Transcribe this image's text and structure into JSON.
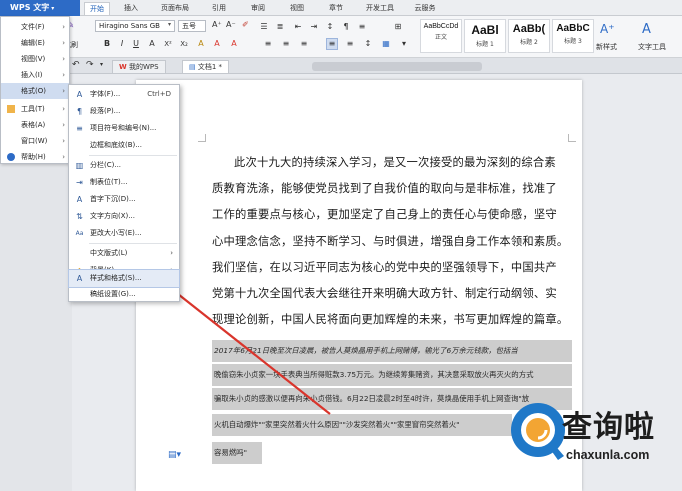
{
  "app": {
    "menu_button": "WPS 文字"
  },
  "ribbon_tabs": [
    "开始",
    "插入",
    "页面布局",
    "引用",
    "审阅",
    "视图",
    "章节",
    "开发工具",
    "云服务"
  ],
  "toolbar": {
    "font_name": "Hiragino Sans GB",
    "font_size": "五号",
    "paste_label": "式刷",
    "new_style_label": "新样式",
    "text_tools_label": "文字工具",
    "styles": [
      {
        "preview": "AaBbCcDd",
        "label": "正文"
      },
      {
        "preview": "AaBl",
        "label": "标题 1"
      },
      {
        "preview": "AaBb(",
        "label": "标题 2"
      },
      {
        "preview": "AaBbC",
        "label": "标题 3"
      }
    ]
  },
  "quickbar": {
    "doc_tabs": [
      "我的WPS",
      "文档1 *"
    ]
  },
  "main_menu": {
    "items": [
      {
        "label": "文件(F)",
        "arrow": "›"
      },
      {
        "label": "编辑(E)",
        "arrow": "›"
      },
      {
        "label": "视图(V)",
        "arrow": "›"
      },
      {
        "label": "插入(I)",
        "arrow": "›"
      },
      {
        "label": "格式(O)",
        "arrow": "›"
      },
      {
        "label": "工具(T)",
        "arrow": "›"
      },
      {
        "label": "表格(A)",
        "arrow": "›"
      },
      {
        "label": "窗口(W)",
        "arrow": "›"
      },
      {
        "label": "帮助(H)",
        "arrow": "›"
      }
    ]
  },
  "format_submenu": {
    "items": [
      {
        "icon": "A",
        "label": "字体(F)...",
        "shortcut": "Ctrl+D"
      },
      {
        "icon": "¶",
        "label": "段落(P)...",
        "shortcut": ""
      },
      {
        "icon": "≡",
        "label": "项目符号和编号(N)...",
        "shortcut": ""
      },
      {
        "icon": "",
        "label": "边框和底纹(B)...",
        "shortcut": ""
      },
      {
        "icon": "▥",
        "label": "分栏(C)...",
        "shortcut": ""
      },
      {
        "icon": "⇥",
        "label": "制表位(T)...",
        "shortcut": ""
      },
      {
        "icon": "A",
        "label": "首字下沉(D)...",
        "shortcut": ""
      },
      {
        "icon": "⇅",
        "label": "文字方向(X)...",
        "shortcut": ""
      },
      {
        "icon": "Aa",
        "label": "更改大小写(E)...",
        "shortcut": ""
      },
      {
        "icon": "",
        "label": "中文版式(L)",
        "shortcut": "›"
      },
      {
        "icon": "◆",
        "label": "背景(K)",
        "shortcut": "›"
      },
      {
        "icon": "A",
        "label": "样式和格式(S)...",
        "shortcut": ""
      },
      {
        "icon": "",
        "label": "稿纸设置(G)...",
        "shortcut": ""
      }
    ]
  },
  "document": {
    "lines": [
      "此次十九大的持续深入学习，是又一次接受的最为深刻的综合素",
      "质教育洗涤，能够使党员找到了自我价值的取向与是非标准，找准了",
      "工作的重要点与核心，更加坚定了自己身上的责任心与使命感，坚守",
      "心中理念信念，坚持不断学习、与时俱进，增强自身工作本领和素质。",
      "我们坚信，在以习近平同志为核心的党中央的坚强领导下，中国共产",
      "党第十九次全国代表大会继往开来明确大政方针、制定行动纲领、实",
      "现理论创新，中国人民将面向更加辉煌的未来，书写更加辉煌的篇章。"
    ],
    "highlighted_lines": [
      "2017年6月21日晚至次日凌晨，被告人莫焕晶用手机上网赌博，输光了6万余元钱款，包括当",
      "晚偷窃朱小贞家一块手表典当所得赃款3.75万元。为继续筹集赌资，其决意采取放火再灭火的方式",
      "骗取朱小贞的感激以便再向朱小贞借钱。6月22日凌晨2时至4时许，莫焕晶使用手机上网查询\"放",
      "火机自动爆炸\"\"家里突然着火什么原因\"\"沙发突然着火\"\"家里窗帘突然着火\"",
      "容易燃吗\""
    ]
  },
  "watermark": {
    "text": "查询啦",
    "url": "chaxunla.com"
  },
  "colors": {
    "wps_blue": "#2d6bc6",
    "arrow_red": "#d9352c",
    "highlight_gray": "#cdcdcd"
  }
}
